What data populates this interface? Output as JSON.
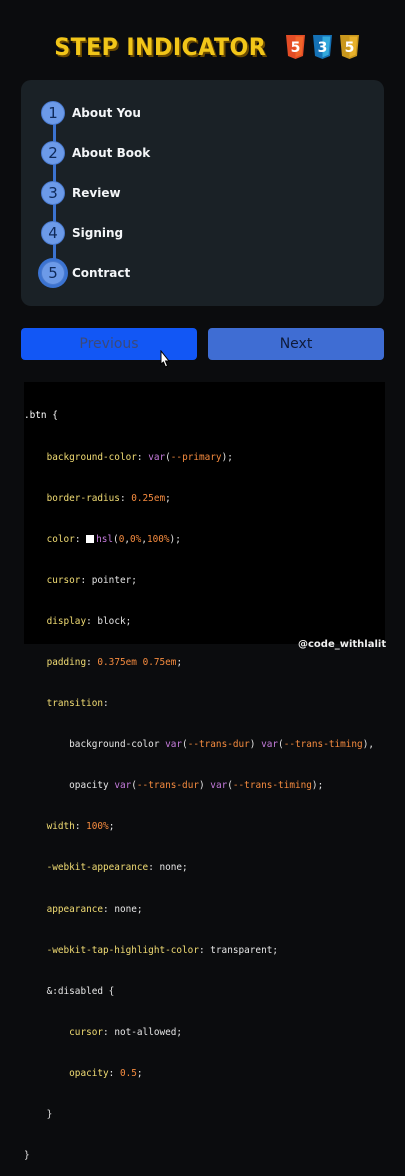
{
  "header": {
    "title": "STEP INDICATOR",
    "badges": [
      {
        "label": "5",
        "icon": "html5-icon",
        "color": "#e44d26"
      },
      {
        "label": "3",
        "icon": "css3-icon",
        "color": "#1e90ff"
      },
      {
        "label": "5",
        "icon": "js-icon",
        "color": "#e8b12b"
      }
    ]
  },
  "steps": [
    {
      "number": "1",
      "label": "About You"
    },
    {
      "number": "2",
      "label": "About Book"
    },
    {
      "number": "3",
      "label": "Review"
    },
    {
      "number": "4",
      "label": "Signing"
    },
    {
      "number": "5",
      "label": "Contract"
    }
  ],
  "active_step": 5,
  "buttons": {
    "previous_label": "Previous",
    "next_label": "Next"
  },
  "code": {
    "lines": [
      ".btn {",
      "    background-color: var(--primary);",
      "    border-radius: 0.25em;",
      "    color: hsl(0,0%,100%);",
      "    cursor: pointer;",
      "    display: block;",
      "    padding: 0.375em 0.75em;",
      "    transition:",
      "        background-color var(--trans-dur) var(--trans-timing),",
      "        opacity var(--trans-dur) var(--trans-timing);",
      "    width: 100%;",
      "    -webkit-appearance: none;",
      "    appearance: none;",
      "    -webkit-tap-highlight-color: transparent;",
      "    &:disabled {",
      "        cursor: not-allowed;",
      "        opacity: 0.5;",
      "    }",
      "}"
    ]
  },
  "watermark": "@code_withlalit",
  "colors": {
    "accent": "#1257f5",
    "title": "#f2c619",
    "card": "#1a2126",
    "step_circle": "#6c9ae8"
  }
}
